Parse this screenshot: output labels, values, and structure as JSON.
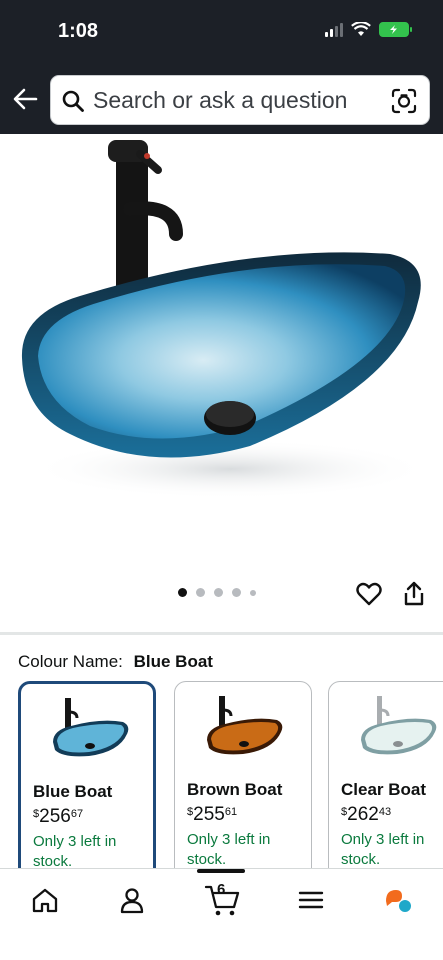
{
  "status_bar": {
    "time": "1:08"
  },
  "search": {
    "placeholder": "Search or ask a question"
  },
  "product": {
    "colour_label": "Colour Name:",
    "colour_value": "Blue Boat",
    "image_count": 5,
    "active_image": 1
  },
  "variants": [
    {
      "name": "Blue Boat",
      "price_currency": "$",
      "price_whole": "256",
      "price_fraction": "67",
      "stock": "Only 3 left in stock.",
      "selected": true
    },
    {
      "name": "Brown Boat",
      "price_currency": "$",
      "price_whole": "255",
      "price_fraction": "61",
      "stock": "Only 3 left in stock.",
      "selected": false
    },
    {
      "name": "Clear Boat",
      "price_currency": "$",
      "price_whole": "262",
      "price_fraction": "43",
      "stock": "Only 3 left in stock.",
      "selected": false
    }
  ],
  "bottom_nav": {
    "cart_count": "6"
  },
  "icons": [
    "back-arrow-icon",
    "search-icon",
    "camera-lens-icon",
    "heart-icon",
    "share-icon",
    "home-icon",
    "account-icon",
    "cart-icon",
    "menu-icon",
    "rufus-icon"
  ],
  "colors": {
    "header_bg": "#1c2027",
    "selected_border": "#1f4a7a",
    "stock_green": "#0b7a3e"
  }
}
